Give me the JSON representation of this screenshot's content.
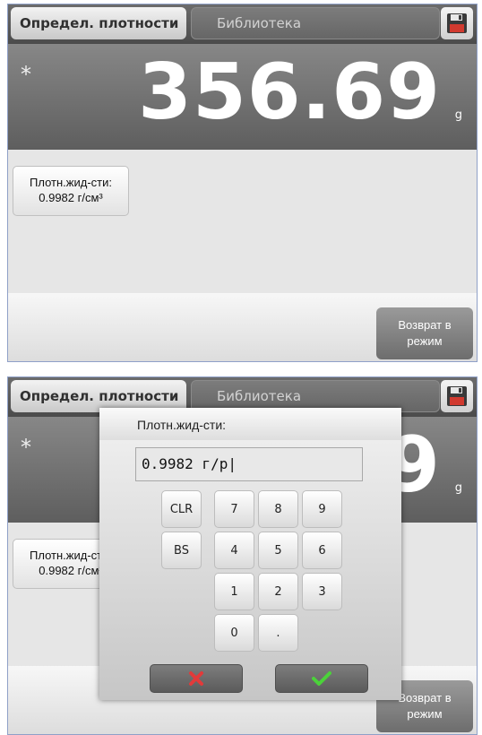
{
  "header": {
    "active_tab": "Определ. плотности",
    "library_tab": "Библиотека",
    "save_icon": "floppy-disk-icon"
  },
  "display": {
    "stability_mark": "*",
    "weight": "356.69",
    "unit": "g"
  },
  "density_param": {
    "label": "Плотн.жид-сти:",
    "value": "0.9982 г/см³"
  },
  "return_button": {
    "line1": "Возврат в",
    "line2": "режим"
  },
  "dialog": {
    "title": "Плотн.жид-сти:",
    "input_value": "0.9982 г/р|",
    "keys": {
      "clr": "CLR",
      "bs": "BS",
      "k7": "7",
      "k8": "8",
      "k9": "9",
      "k4": "4",
      "k5": "5",
      "k6": "6",
      "k1": "1",
      "k2": "2",
      "k3": "3",
      "k0": "0",
      "dot": "."
    },
    "cancel_icon": "red-x-icon",
    "ok_icon": "green-check-icon"
  },
  "colors": {
    "cancel": "#e23a3a",
    "ok": "#4bd23a"
  }
}
